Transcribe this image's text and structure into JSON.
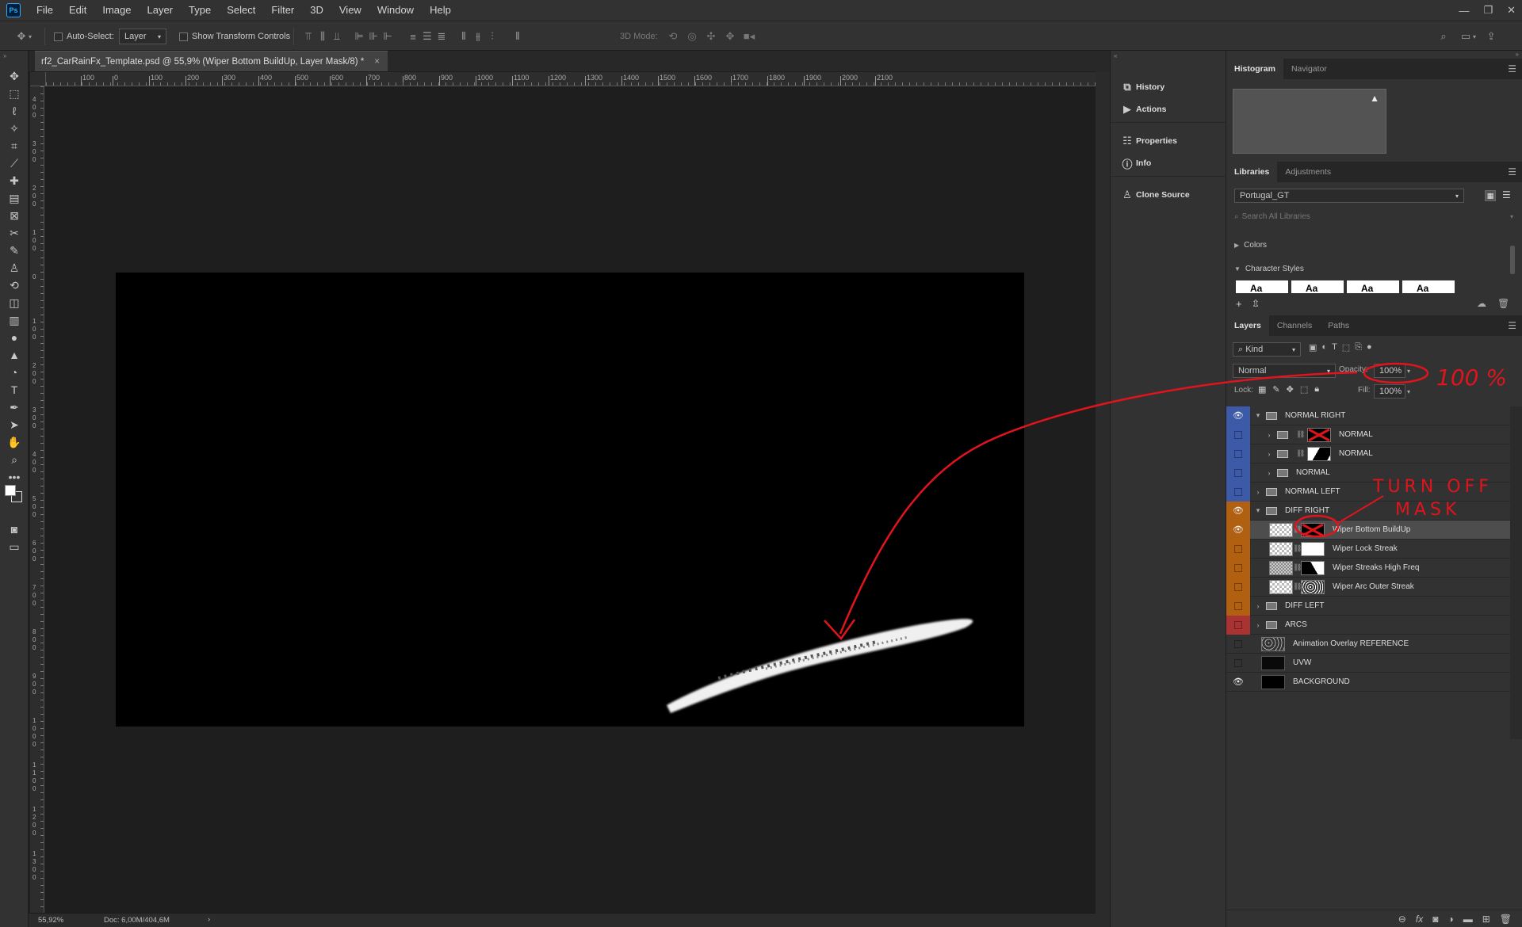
{
  "app_icon": "Ps",
  "menu": [
    "File",
    "Edit",
    "Image",
    "Layer",
    "Type",
    "Select",
    "Filter",
    "3D",
    "View",
    "Window",
    "Help"
  ],
  "window_controls": [
    "minimize-icon",
    "restore-icon",
    "close-icon"
  ],
  "options": {
    "auto_select_label": "Auto-Select:",
    "auto_select_value": "Layer",
    "show_transform_label": "Show Transform Controls",
    "mode_3d_label": "3D Mode:"
  },
  "document": {
    "tab_title": "rf2_CarRainFx_Template.psd @ 55,9% (Wiper Bottom BuildUp, Layer Mask/8) *",
    "close": "×",
    "hruler": [
      "100",
      "0",
      "100",
      "200",
      "300",
      "400",
      "500",
      "600",
      "700",
      "800",
      "900",
      "1000",
      "1100",
      "1200",
      "1300",
      "1400",
      "1500",
      "1600",
      "1700",
      "1800",
      "1900",
      "2000",
      "2100"
    ],
    "vruler": [
      "4\n0\n0",
      "3\n0\n0",
      "2\n0\n0",
      "1\n0\n0",
      "0",
      "1\n0\n0",
      "2\n0\n0",
      "3\n0\n0",
      "4\n0\n0",
      "5\n0\n0",
      "6\n0\n0",
      "7\n0\n0",
      "8\n0\n0",
      "9\n0\n0",
      "1\n0\n0\n0",
      "1\n1\n0\n0",
      "1\n2\n0\n0",
      "1\n3\n0\n0"
    ]
  },
  "status": {
    "zoom": "55,92%",
    "doc": "Doc: 6,00M/404,6M",
    "arrow": "›"
  },
  "dock": [
    {
      "label": "History",
      "icon": "history-icon",
      "glyph": "⧉"
    },
    {
      "label": "Actions",
      "icon": "play-icon",
      "glyph": "▶"
    },
    {
      "label": "Properties",
      "icon": "properties-icon",
      "glyph": "☷"
    },
    {
      "label": "Info",
      "icon": "info-icon",
      "glyph": "ⓘ"
    },
    {
      "label": "Clone Source",
      "icon": "clone-stamp-icon",
      "glyph": "♙"
    }
  ],
  "panels": {
    "top_tabs": [
      "Histogram",
      "Navigator"
    ],
    "lib_tabs": [
      "Libraries",
      "Adjustments"
    ],
    "library_select": "Portugal_GT",
    "search_placeholder": "Search All Libraries",
    "colors_label": "Colors",
    "char_styles_label": "Character Styles",
    "char_style_glyph": "Aa",
    "layer_tabs": [
      "Layers",
      "Channels",
      "Paths"
    ],
    "kind_label": "Kind",
    "blend_mode": "Normal",
    "opacity_label": "Opacity:",
    "opacity_value": "100%",
    "lock_label": "Lock:",
    "fill_label": "Fill:",
    "fill_value": "100%"
  },
  "colors": {
    "blue": "#3d5aa8",
    "orange": "#b06010",
    "red": "#a93232",
    "accent": "#31a8ff",
    "annotation": "#e0141c"
  },
  "layers": [
    {
      "name": "NORMAL RIGHT",
      "type": "group",
      "indent": 0,
      "visible": true,
      "color": "blue",
      "expanded": true
    },
    {
      "name": "NORMAL",
      "type": "group",
      "indent": 1,
      "visible": false,
      "color": "blue",
      "expanded": false,
      "mask": "red-x"
    },
    {
      "name": "NORMAL",
      "type": "group",
      "indent": 1,
      "visible": false,
      "color": "blue",
      "expanded": false,
      "mask": "white-black"
    },
    {
      "name": "NORMAL",
      "type": "group",
      "indent": 1,
      "visible": false,
      "color": "blue",
      "expanded": false,
      "mask": "none"
    },
    {
      "name": "NORMAL LEFT",
      "type": "group",
      "indent": 0,
      "visible": false,
      "color": "blue",
      "expanded": false
    },
    {
      "name": "DIFF RIGHT",
      "type": "group",
      "indent": 0,
      "visible": true,
      "color": "orange",
      "expanded": true
    },
    {
      "name": "Wiper Bottom BuildUp",
      "type": "layer",
      "indent": 1,
      "visible": true,
      "color": "orange",
      "mask": "red-x",
      "selected": true
    },
    {
      "name": "Wiper Lock Streak",
      "type": "layer",
      "indent": 1,
      "visible": false,
      "color": "orange",
      "mask": "white"
    },
    {
      "name": "Wiper Streaks High Freq",
      "type": "layer",
      "indent": 1,
      "visible": false,
      "color": "orange",
      "mask": "black-white",
      "thumb": "gray"
    },
    {
      "name": "Wiper Arc Outer Streak",
      "type": "layer",
      "indent": 1,
      "visible": false,
      "color": "orange",
      "mask": "speckle"
    },
    {
      "name": "DIFF LEFT",
      "type": "group",
      "indent": 0,
      "visible": false,
      "color": "orange",
      "expanded": false
    },
    {
      "name": "ARCS",
      "type": "group",
      "indent": 0,
      "visible": false,
      "color": "red",
      "expanded": false
    },
    {
      "name": "Animation Overlay REFERENCE",
      "type": "layer",
      "indent": 0,
      "visible": false,
      "color": "none",
      "thumb": "speckle"
    },
    {
      "name": "UVW",
      "type": "layer",
      "indent": 0,
      "visible": false,
      "color": "none",
      "thumb": "dark"
    },
    {
      "name": "BACKGROUND",
      "type": "layer",
      "indent": 0,
      "visible": true,
      "color": "none",
      "thumb": "black"
    }
  ],
  "annotations": {
    "percent": "100 %",
    "line1": "TURN OFF",
    "line2": "MASK"
  }
}
